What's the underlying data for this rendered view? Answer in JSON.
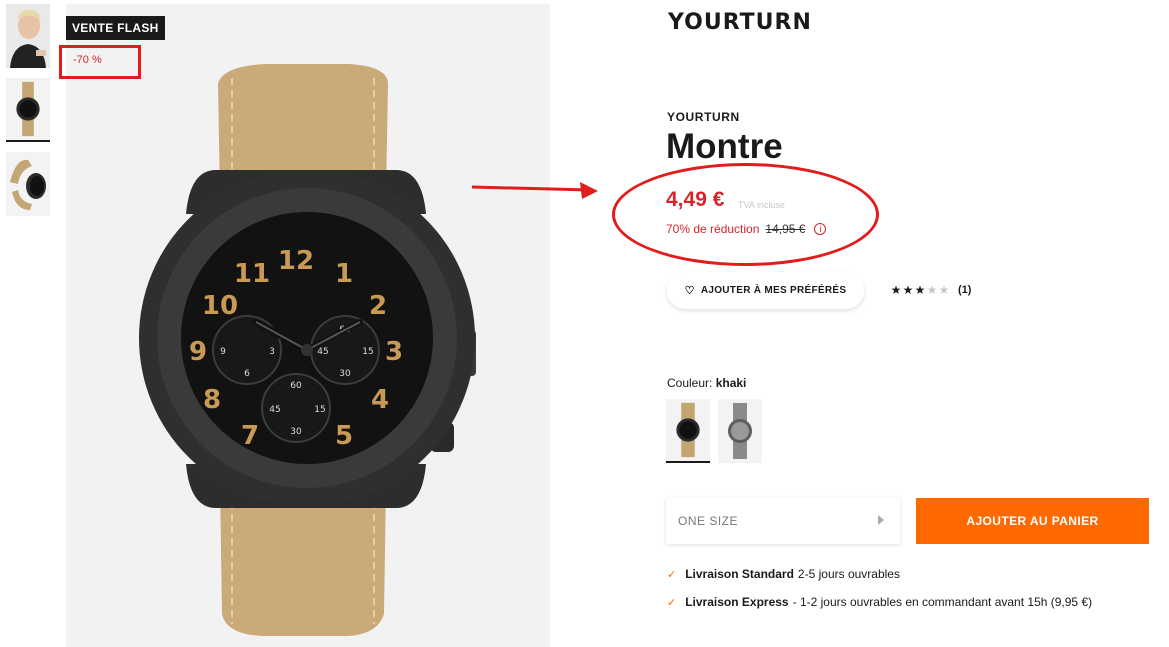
{
  "badges": {
    "flash": "VENTE FLASH",
    "discount": "-70 %"
  },
  "brand": {
    "logo": "YOURTURN",
    "name": "YOURTURN"
  },
  "product": {
    "title": "Montre",
    "price": "4,49 €",
    "vat_note": "TVA incluse",
    "reduction_label": "70% de réduction",
    "old_price": "14,95 €"
  },
  "favorites": {
    "label": "AJOUTER À MES PRÉFÉRÉS",
    "icon": "heart-icon"
  },
  "rating": {
    "value": 3,
    "max": 5,
    "count": "(1)"
  },
  "color": {
    "label": "Couleur:",
    "value": "khaki",
    "swatches": [
      "khaki",
      "grey"
    ]
  },
  "size": {
    "value": "ONE SIZE"
  },
  "cart": {
    "label": "AJOUTER AU PANIER"
  },
  "delivery": [
    {
      "title": "Livraison Standard",
      "detail": "2-5 jours ouvrables"
    },
    {
      "title": "Livraison Express",
      "detail": "- 1-2 jours ouvrables en commandant avant 15h (9,95 €)"
    }
  ],
  "colors": {
    "accent": "#ff6900",
    "price_red": "#d6242a",
    "annotation_red": "#e21b1b",
    "strap_khaki": "#c4a574"
  }
}
